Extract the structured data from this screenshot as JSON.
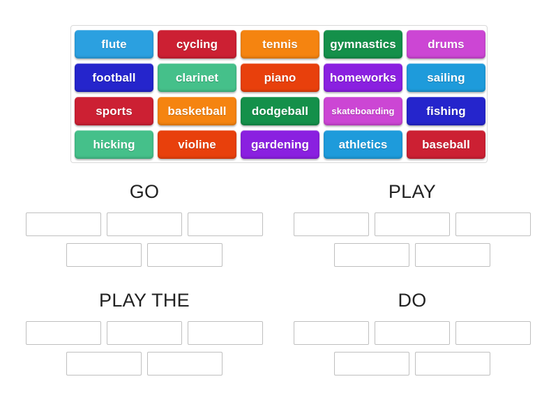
{
  "word_bank": {
    "rows": [
      [
        {
          "label": "flute",
          "color": "#2ba0e0"
        },
        {
          "label": "cycling",
          "color": "#cc2033"
        },
        {
          "label": "tennis",
          "color": "#f58410"
        },
        {
          "label": "gymnastics",
          "color": "#14904a"
        },
        {
          "label": "drums",
          "color": "#cc46d4"
        }
      ],
      [
        {
          "label": "football",
          "color": "#2525cc"
        },
        {
          "label": "clarinet",
          "color": "#45c08a"
        },
        {
          "label": "piano",
          "color": "#e8400c"
        },
        {
          "label": "homeworks",
          "color": "#8a20e0"
        },
        {
          "label": "sailing",
          "color": "#1e9bdb"
        }
      ],
      [
        {
          "label": "sports",
          "color": "#cc2033"
        },
        {
          "label": "basketball",
          "color": "#f58410"
        },
        {
          "label": "dodgeball",
          "color": "#14904a"
        },
        {
          "label": "skateboarding",
          "color": "#cc46d4",
          "small": true
        },
        {
          "label": "fishing",
          "color": "#2525cc"
        }
      ],
      [
        {
          "label": "hicking",
          "color": "#45c08a"
        },
        {
          "label": "violine",
          "color": "#e8400c"
        },
        {
          "label": "gardening",
          "color": "#8a20e0"
        },
        {
          "label": "athletics",
          "color": "#1e9bdb"
        },
        {
          "label": "baseball",
          "color": "#cc2033"
        }
      ]
    ]
  },
  "groups": [
    {
      "title": "GO",
      "row_a_slots": [
        "",
        "",
        ""
      ],
      "row_b_slots": [
        "",
        ""
      ]
    },
    {
      "title": "PLAY",
      "row_a_slots": [
        "",
        "",
        ""
      ],
      "row_b_slots": [
        "",
        ""
      ]
    },
    {
      "title": "PLAY THE",
      "row_a_slots": [
        "",
        "",
        ""
      ],
      "row_b_slots": [
        "",
        ""
      ]
    },
    {
      "title": "DO",
      "row_a_slots": [
        "",
        "",
        ""
      ],
      "row_b_slots": [
        "",
        ""
      ]
    }
  ]
}
